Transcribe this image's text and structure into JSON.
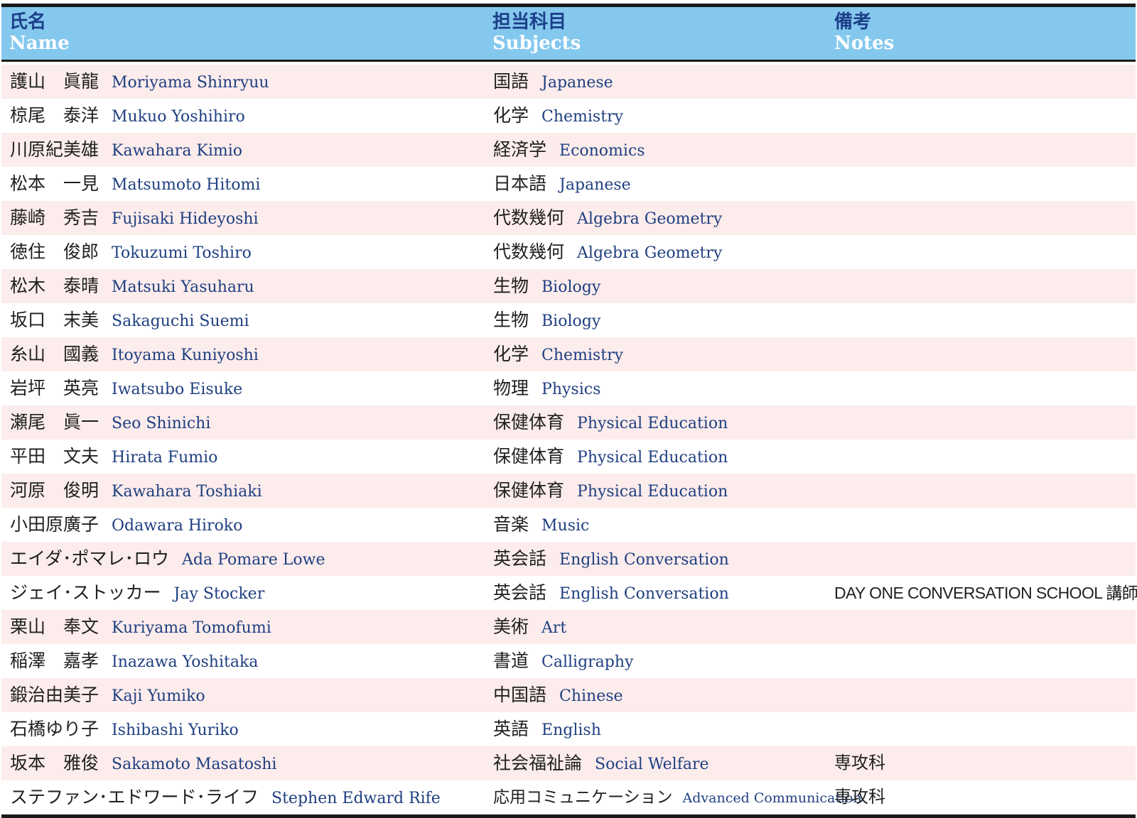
{
  "header": {
    "name_jp": "氏名",
    "name_en": "Name",
    "subject_jp": "担当科目",
    "subject_en": "Subjects",
    "notes_jp": "備考",
    "notes_en": "Notes"
  },
  "rows": [
    {
      "name_jp": "護山　眞龍",
      "name_en": "Moriyama Shinryuu",
      "subject_jp": "国語",
      "subject_en": "Japanese",
      "note": ""
    },
    {
      "name_jp": "椋尾　泰洋",
      "name_en": "Mukuo Yoshihiro",
      "subject_jp": "化学",
      "subject_en": "Chemistry",
      "note": ""
    },
    {
      "name_jp": "川原紀美雄",
      "name_en": "Kawahara Kimio",
      "subject_jp": "経済学",
      "subject_en": "Economics",
      "note": ""
    },
    {
      "name_jp": "松本　一見",
      "name_en": "Matsumoto Hitomi",
      "subject_jp": "日本語",
      "subject_en": "Japanese",
      "note": ""
    },
    {
      "name_jp": "藤崎　秀吉",
      "name_en": "Fujisaki Hideyoshi",
      "subject_jp": "代数幾何",
      "subject_en": "Algebra Geometry",
      "note": ""
    },
    {
      "name_jp": "徳住　俊郎",
      "name_en": "Tokuzumi Toshiro",
      "subject_jp": "代数幾何",
      "subject_en": "Algebra Geometry",
      "note": ""
    },
    {
      "name_jp": "松木　泰晴",
      "name_en": "Matsuki Yasuharu",
      "subject_jp": "生物",
      "subject_en": "Biology",
      "note": ""
    },
    {
      "name_jp": "坂口　末美",
      "name_en": "Sakaguchi Suemi",
      "subject_jp": "生物",
      "subject_en": "Biology",
      "note": ""
    },
    {
      "name_jp": "糸山　國義",
      "name_en": "Itoyama Kuniyoshi",
      "subject_jp": "化学",
      "subject_en": "Chemistry",
      "note": ""
    },
    {
      "name_jp": "岩坪　英亮",
      "name_en": "Iwatsubo Eisuke",
      "subject_jp": "物理",
      "subject_en": "Physics",
      "note": ""
    },
    {
      "name_jp": "瀬尾　眞一",
      "name_en": "Seo Shinichi",
      "subject_jp": "保健体育",
      "subject_en": "Physical Education",
      "note": ""
    },
    {
      "name_jp": "平田　文夫",
      "name_en": "Hirata Fumio",
      "subject_jp": "保健体育",
      "subject_en": "Physical Education",
      "note": ""
    },
    {
      "name_jp": "河原　俊明",
      "name_en": "Kawahara Toshiaki",
      "subject_jp": "保健体育",
      "subject_en": "Physical Education",
      "note": ""
    },
    {
      "name_jp": "小田原廣子",
      "name_en": "Odawara Hiroko",
      "subject_jp": "音楽",
      "subject_en": "Music",
      "note": ""
    },
    {
      "name_jp": "エイダ･ポマレ･ロウ",
      "name_en": "Ada Pomare Lowe",
      "subject_jp": "英会話",
      "subject_en": "English Conversation",
      "note": ""
    },
    {
      "name_jp": "ジェイ･ストッカー",
      "name_en": "Jay Stocker",
      "subject_jp": "英会話",
      "subject_en": "English Conversation",
      "note": "DAY ONE CONVERSATION SCHOOL 講師"
    },
    {
      "name_jp": "栗山　奉文",
      "name_en": "Kuriyama Tomofumi",
      "subject_jp": "美術",
      "subject_en": "Art",
      "note": ""
    },
    {
      "name_jp": "稲澤　嘉孝",
      "name_en": "Inazawa Yoshitaka",
      "subject_jp": "書道",
      "subject_en": "Calligraphy",
      "note": ""
    },
    {
      "name_jp": "鍛治由美子",
      "name_en": "Kaji Yumiko",
      "subject_jp": "中国語",
      "subject_en": "Chinese",
      "note": ""
    },
    {
      "name_jp": "石橋ゆり子",
      "name_en": "Ishibashi Yuriko",
      "subject_jp": "英語",
      "subject_en": "English",
      "note": ""
    },
    {
      "name_jp": "坂本　雅俊",
      "name_en": "Sakamoto Masatoshi",
      "subject_jp": "社会福祉論",
      "subject_en": "Social Welfare",
      "note": "専攻科"
    },
    {
      "name_jp": "ステファン･エドワード･ライフ",
      "name_en": "Stephen Edward Rife",
      "subject_jp": "応用コミュニケーション",
      "subject_en": "Advanced Communication",
      "note": "専攻科"
    }
  ],
  "colors": {
    "header_bg": "#85c8ee",
    "header_jp_text": "#1c3f8a",
    "header_en_text": "#ffffff",
    "row_alt_bg": "#fcecec",
    "english_text": "#1f3f80",
    "rule": "#1a1a1a"
  }
}
